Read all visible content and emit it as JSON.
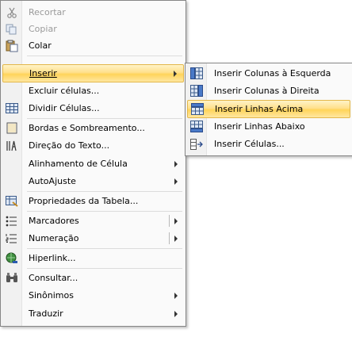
{
  "menu": {
    "recortar": "Recortar",
    "copiar": "Copiar",
    "colar": "Colar",
    "inserir": "Inserir",
    "excluir_celulas": "Excluir células...",
    "dividir_celulas": "Dividir Células...",
    "bordas": "Bordas e Sombreamento...",
    "direcao": "Direção do Texto...",
    "alinhamento": "Alinhamento de Célula",
    "autoajuste": "AutoAjuste",
    "propriedades": "Propriedades da Tabela...",
    "marcadores": "Marcadores",
    "numeracao": "Numeração",
    "hiperlink": "Hiperlink...",
    "consultar": "Consultar...",
    "sinonimos": "Sinônimos",
    "traduzir": "Traduzir"
  },
  "submenu": {
    "colunas_esquerda": "Inserir Colunas à Esquerda",
    "colunas_direita": "Inserir Colunas à Direita",
    "linhas_acima": "Inserir Linhas Acima",
    "linhas_abaixo": "Inserir Linhas Abaixo",
    "celulas": "Inserir Células..."
  },
  "icons": {
    "cut": "scissors-icon",
    "copy": "copy-icon",
    "paste": "paste-icon",
    "split": "split-cells-icon",
    "borders": "borders-icon",
    "direction": "text-direction-icon",
    "properties": "table-properties-icon",
    "bullets": "bullets-icon",
    "numbering": "numbering-icon",
    "hyperlink": "hyperlink-icon",
    "lookup": "lookup-icon"
  },
  "colors": {
    "highlight": "#ffd45a",
    "disabled_text": "#9a9a9a",
    "border": "#868686"
  }
}
